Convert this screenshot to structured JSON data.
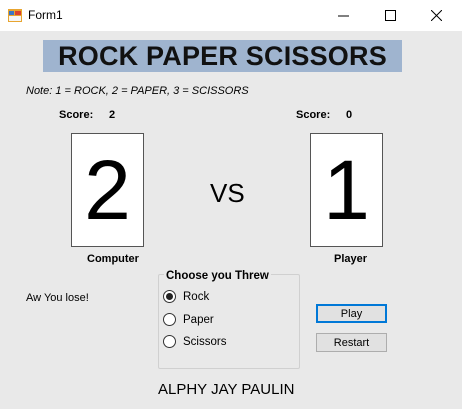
{
  "window": {
    "title": "Form1",
    "icon": "winforms-app-icon",
    "controls": [
      "minimize-icon",
      "maximize-icon",
      "close-icon"
    ]
  },
  "header": {
    "banner": "ROCK PAPER SCISSORS"
  },
  "note": "Note: 1 = ROCK, 2 = PAPER, 3 = SCISSORS",
  "computer": {
    "score_label": "Score:",
    "score": "2",
    "number": "2",
    "name": "Computer"
  },
  "player": {
    "score_label": "Score:",
    "score": "0",
    "number": "1",
    "name": "Player"
  },
  "vs": "VS",
  "result": "Aw You lose!",
  "choices": {
    "title": "Choose you Threw",
    "options": [
      {
        "label": "Rock",
        "selected": true
      },
      {
        "label": "Paper",
        "selected": false
      },
      {
        "label": "Scissors",
        "selected": false
      }
    ]
  },
  "buttons": {
    "play": "Play",
    "restart": "Restart"
  },
  "footer": {
    "author": "ALPHY JAY PAULIN"
  },
  "colors": {
    "banner_bg": "#9fb4cf",
    "form_bg": "#e9e9e9",
    "focus_border": "#0078d7"
  }
}
